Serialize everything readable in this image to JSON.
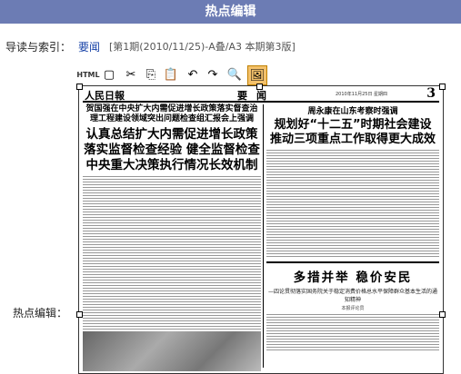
{
  "header": {
    "title": "热点编辑"
  },
  "guide": {
    "label": "导读与索引：",
    "link_text": "要闻",
    "meta_text": "[第1期(2010/11/25)-A叠/A3 本期第3版]"
  },
  "hot_edit": {
    "label": "热点编辑："
  },
  "toolbar": {
    "items": [
      {
        "name": "html-mode",
        "label": "HTML"
      },
      {
        "name": "fullscreen",
        "label": "▢"
      },
      {
        "name": "cut",
        "label": "✂"
      },
      {
        "name": "copy",
        "label": "⎘"
      },
      {
        "name": "paste",
        "label": "📋"
      },
      {
        "name": "undo",
        "label": "↶"
      },
      {
        "name": "redo",
        "label": "↷"
      },
      {
        "name": "preview",
        "label": "🔍"
      },
      {
        "name": "image",
        "label": "🖼"
      }
    ]
  },
  "newspaper": {
    "logo": "人民日報",
    "section": "要闻",
    "date": "2010年11月25日 星期四",
    "page": "3",
    "left_kicker": "贺国强在中央扩大内需促进增长政策落实督查治理工程建设领域突出问题检查组汇报会上强调",
    "left_headline": "认真总结扩大内需促进增长政策落实监督检查经验 健全监督检查中央重大决策执行情况长效机制",
    "right_kicker": "周永康在山东考察时强调",
    "right_headline": "规划好“十二五”时期社会建设 推动三项重点工作取得更大成效",
    "right2_headline": "多措并举 稳价安民",
    "right2_sub": "—四论贯彻落实国务院关于稳定消费价格总水平保障群众基本生活的通知精神",
    "right2_author": "本报评论员"
  }
}
